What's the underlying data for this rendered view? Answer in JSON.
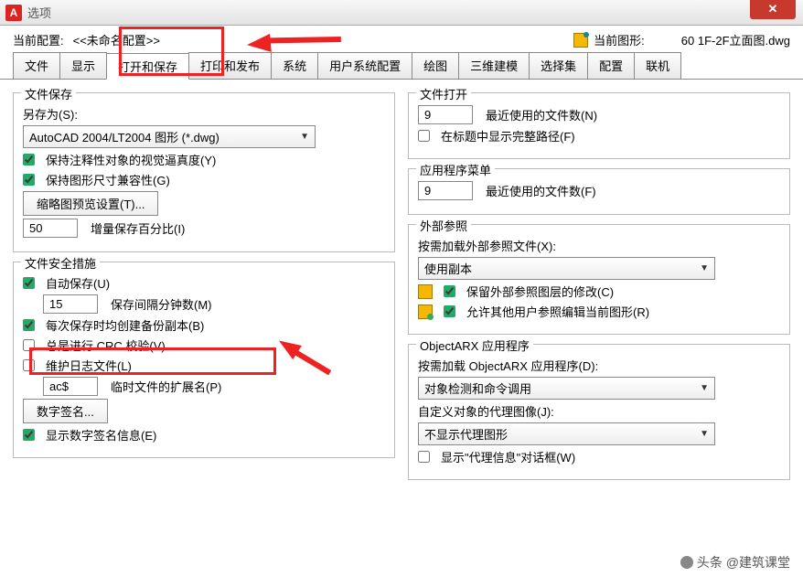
{
  "window": {
    "title": "选项",
    "icon_letter": "A"
  },
  "profile": {
    "label": "当前配置:",
    "value": "<<未命名配置>>",
    "drawing_label": "当前图形:",
    "drawing_value": "60 1F-2F立面图.dwg"
  },
  "tabs": [
    "文件",
    "显示",
    "打开和保存",
    "打印和发布",
    "系统",
    "用户系统配置",
    "绘图",
    "三维建模",
    "选择集",
    "配置",
    "联机"
  ],
  "active_tab": 2,
  "left": {
    "g1": {
      "title": "文件保存",
      "saveas_label": "另存为(S):",
      "combo": "AutoCAD 2004/LT2004 图形 (*.dwg)",
      "cb1": "保持注释性对象的视觉逼真度(Y)",
      "cb2": "保持图形尺寸兼容性(G)",
      "btn_thumb": "缩略图预览设置(T)...",
      "incr_val": "50",
      "incr_lbl": "增量保存百分比(I)"
    },
    "g2": {
      "title": "文件安全措施",
      "cb_auto": "自动保存(U)",
      "min_val": "15",
      "min_lbl": "保存间隔分钟数(M)",
      "cb_bak": "每次保存时均创建备份副本(B)",
      "cb_crc": "总是进行 CRC 校验(V)",
      "cb_log": "维护日志文件(L)",
      "ext_val": "ac$",
      "ext_lbl": "临时文件的扩展名(P)",
      "btn_sig": "数字签名...",
      "cb_sig": "显示数字签名信息(E)"
    }
  },
  "right": {
    "g1": {
      "title": "文件打开",
      "rf_val": "9",
      "rf_lbl": "最近使用的文件数(N)",
      "cb_full": "在标题中显示完整路径(F)"
    },
    "g2": {
      "title": "应用程序菜单",
      "rf_val": "9",
      "rf_lbl": "最近使用的文件数(F)"
    },
    "g3": {
      "title": "外部参照",
      "lbl": "按需加载外部参照文件(X):",
      "combo": "使用副本",
      "cb1": "保留外部参照图层的修改(C)",
      "cb2": "允许其他用户参照编辑当前图形(R)"
    },
    "g4": {
      "title": "ObjectARX 应用程序",
      "lbl1": "按需加载 ObjectARX 应用程序(D):",
      "combo1": "对象检测和命令调用",
      "lbl2": "自定义对象的代理图像(J):",
      "combo2": "不显示代理图形",
      "cb": "显示\"代理信息\"对话框(W)"
    }
  },
  "footer": {
    "text": "头条 @建筑课堂"
  }
}
